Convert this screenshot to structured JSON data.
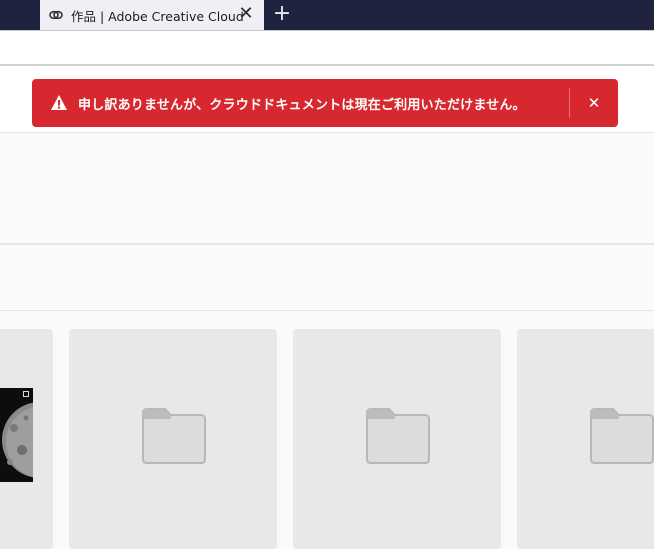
{
  "browser": {
    "tab_title": "作品 | Adobe Creative Cloud",
    "tab_close_glyph": "✕",
    "new_tab_glyph": "+",
    "favicon": "creative-cloud-icon"
  },
  "alert": {
    "message": "申し訳ありませんが、クラウドドキュメントは現在ご利用いただけません。",
    "close_glyph": "✕",
    "icon": "warning-icon",
    "color": "#d7282f"
  },
  "cards": [
    {
      "type": "image",
      "icon": "moon-image-thumbnail"
    },
    {
      "type": "folder",
      "icon": "folder-icon"
    },
    {
      "type": "folder",
      "icon": "folder-icon"
    },
    {
      "type": "folder",
      "icon": "folder-icon"
    }
  ],
  "colors": {
    "tabbar": "#20233f",
    "card": "#e8e8e8",
    "folder": "#cfcfcf"
  }
}
